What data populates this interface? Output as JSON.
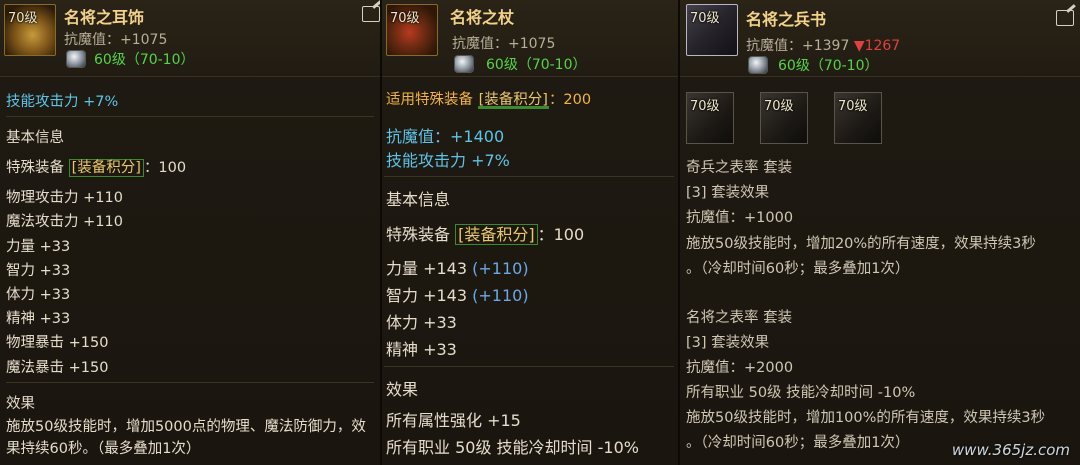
{
  "panels": [
    {
      "level": "70级",
      "name": "名将之耳饰",
      "resist": "抗魔值：+1075",
      "gem_text": "60级（70-10）",
      "lines": {
        "skill_atk": "技能攻击力 +7%",
        "basic_info": "基本信息",
        "special_prefix": "特殊装备",
        "special_bracket": "[装备积分]",
        "special_suffix": "：100",
        "phys_atk": "物理攻击力 +110",
        "magic_atk": "魔法攻击力 +110",
        "str": "力量 +33",
        "int": "智力 +33",
        "vit": "体力 +33",
        "spr": "精神 +33",
        "phys_crit": "物理暴击 +150",
        "magic_crit": "魔法暴击 +150",
        "effect": "效果",
        "effect_desc_1": "施放50级技能时，增加5000点的物理、魔法防御力，效",
        "effect_desc_2": "果持续60秒。（最多叠加1次）"
      }
    },
    {
      "level": "70级",
      "name": "名将之杖",
      "resist": "抗魔值：+1075",
      "gem_text": "60级（70-10）",
      "lines": {
        "applicable_prefix": "适用特殊装备",
        "applicable_bracket": "[装备积分]",
        "applicable_suffix": "：200",
        "resist_big": "抗魔值：+1400",
        "skill_atk": "技能攻击力 +7%",
        "basic_info": "基本信息",
        "special_prefix": "特殊装备",
        "special_bracket": "[装备积分]",
        "special_suffix": "：100",
        "str": "力量 +143",
        "str_bonus": "(+110)",
        "int": "智力 +143",
        "int_bonus": "(+110)",
        "vit": "体力 +33",
        "spr": "精神 +33",
        "effect": "效果",
        "all_attr": "所有属性强化 +15",
        "cooldown": "所有职业 50级 技能冷却时间 -10%"
      }
    },
    {
      "level": "70级",
      "name": "名将之兵书",
      "resist_prefix": "抗魔值：+1397",
      "resist_down": "▼1267",
      "gem_text": "60级（70-10）",
      "set_levels": [
        "70级",
        "70级",
        "70级"
      ],
      "lines": {
        "set1_name": "奇兵之表率 套装",
        "set1_effect": "[3] 套装效果",
        "set1_resist": "抗魔值：+1000",
        "set1_desc_1": "施放50级技能时，增加20%的所有速度，效果持续3秒",
        "set1_desc_2": "。（冷却时间60秒；最多叠加1次）",
        "set2_name": "名将之表率 套装",
        "set2_effect": "[3] 套装效果",
        "set2_resist": "抗魔值：+2000",
        "set2_cooldown": "所有职业 50级 技能冷却时间 -10%",
        "set2_desc_1": "施放50级技能时，增加100%的所有速度，效果持续3秒",
        "set2_desc_2": "。（冷却时间60秒；最多叠加1次）"
      }
    }
  ],
  "watermark": "www.365jz.com"
}
